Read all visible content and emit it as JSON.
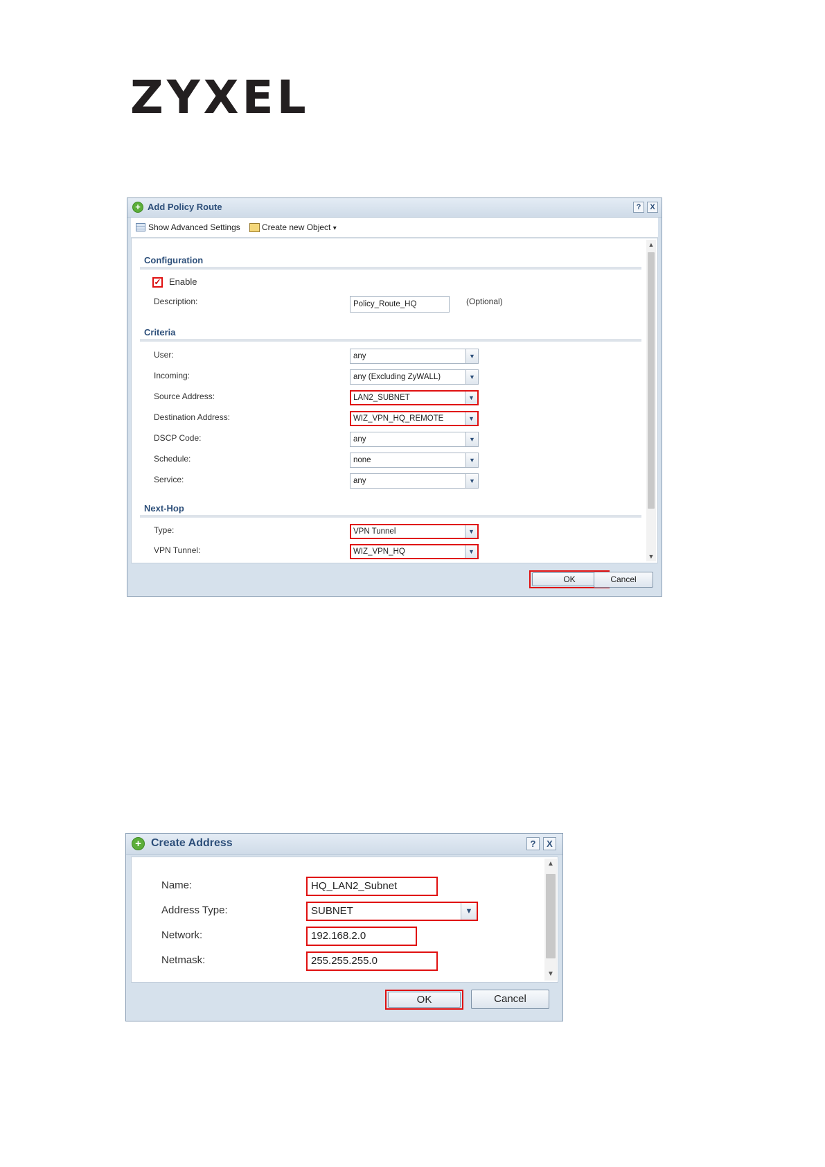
{
  "logo": {
    "text": "ZYXEL"
  },
  "policy_dialog": {
    "title": "Add Policy Route",
    "help_label": "?",
    "close_label": "X",
    "toolbar": {
      "show_advanced": "Show Advanced Settings",
      "create_object": "Create new Object",
      "create_object_arrow": "▾"
    },
    "configuration": {
      "heading": "Configuration",
      "enable_label": "Enable",
      "enable_checked": true,
      "description_label": "Description:",
      "description_value": "Policy_Route_HQ",
      "description_hint": "(Optional)"
    },
    "criteria": {
      "heading": "Criteria",
      "user_label": "User:",
      "user_value": "any",
      "incoming_label": "Incoming:",
      "incoming_value": "any (Excluding ZyWALL)",
      "source_label": "Source Address:",
      "source_value": "LAN2_SUBNET",
      "destination_label": "Destination Address:",
      "destination_value": "WIZ_VPN_HQ_REMOTE",
      "dscp_label": "DSCP Code:",
      "dscp_value": "any",
      "schedule_label": "Schedule:",
      "schedule_value": "none",
      "service_label": "Service:",
      "service_value": "any"
    },
    "next_hop": {
      "heading": "Next-Hop",
      "type_label": "Type:",
      "type_value": "VPN Tunnel",
      "tunnel_label": "VPN Tunnel:",
      "tunnel_value": "WIZ_VPN_HQ"
    },
    "ok_label": "OK",
    "cancel_label": "Cancel"
  },
  "address_dialog": {
    "title": "Create Address",
    "help_label": "?",
    "close_label": "X",
    "name_label": "Name:",
    "name_value": "HQ_LAN2_Subnet",
    "type_label": "Address Type:",
    "type_value": "SUBNET",
    "network_label": "Network:",
    "network_value": "192.168.2.0",
    "netmask_label": "Netmask:",
    "netmask_value": "255.255.255.0",
    "ok_label": "OK",
    "cancel_label": "Cancel"
  },
  "colors": {
    "highlight": "#e01010",
    "heading": "#2d4f7a",
    "dialog_bg": "#d6e1ec"
  }
}
